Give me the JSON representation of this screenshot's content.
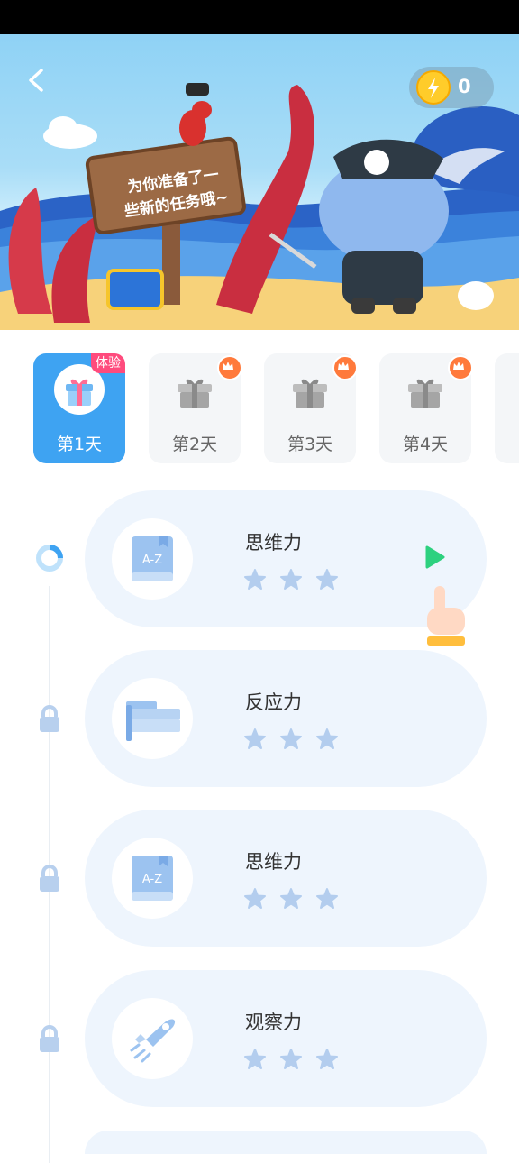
{
  "header": {
    "coins": "0",
    "sign_text_line1": "为你准备了一",
    "sign_text_line2": "些新的任务哦~"
  },
  "days": [
    {
      "label": "第1天",
      "badge": "体验",
      "active": true
    },
    {
      "label": "第2天",
      "active": false
    },
    {
      "label": "第3天",
      "active": false
    },
    {
      "label": "第4天",
      "active": false
    }
  ],
  "tasks": [
    {
      "title": "思维力",
      "icon": "book-az-icon",
      "stars": 3,
      "status": "current"
    },
    {
      "title": "反应力",
      "icon": "board-icon",
      "stars": 3,
      "status": "locked"
    },
    {
      "title": "思维力",
      "icon": "book-az-icon",
      "stars": 3,
      "status": "locked"
    },
    {
      "title": "观察力",
      "icon": "rocket-icon",
      "stars": 3,
      "status": "locked"
    }
  ],
  "colors": {
    "accent": "#3ea3f2",
    "card_bg": "#eef5fd",
    "star": "#b3cdee",
    "lock": "#b8d0ee",
    "badge": "#ff4b7d",
    "crown": "#ff7a3c",
    "play": "#2dd17f"
  }
}
